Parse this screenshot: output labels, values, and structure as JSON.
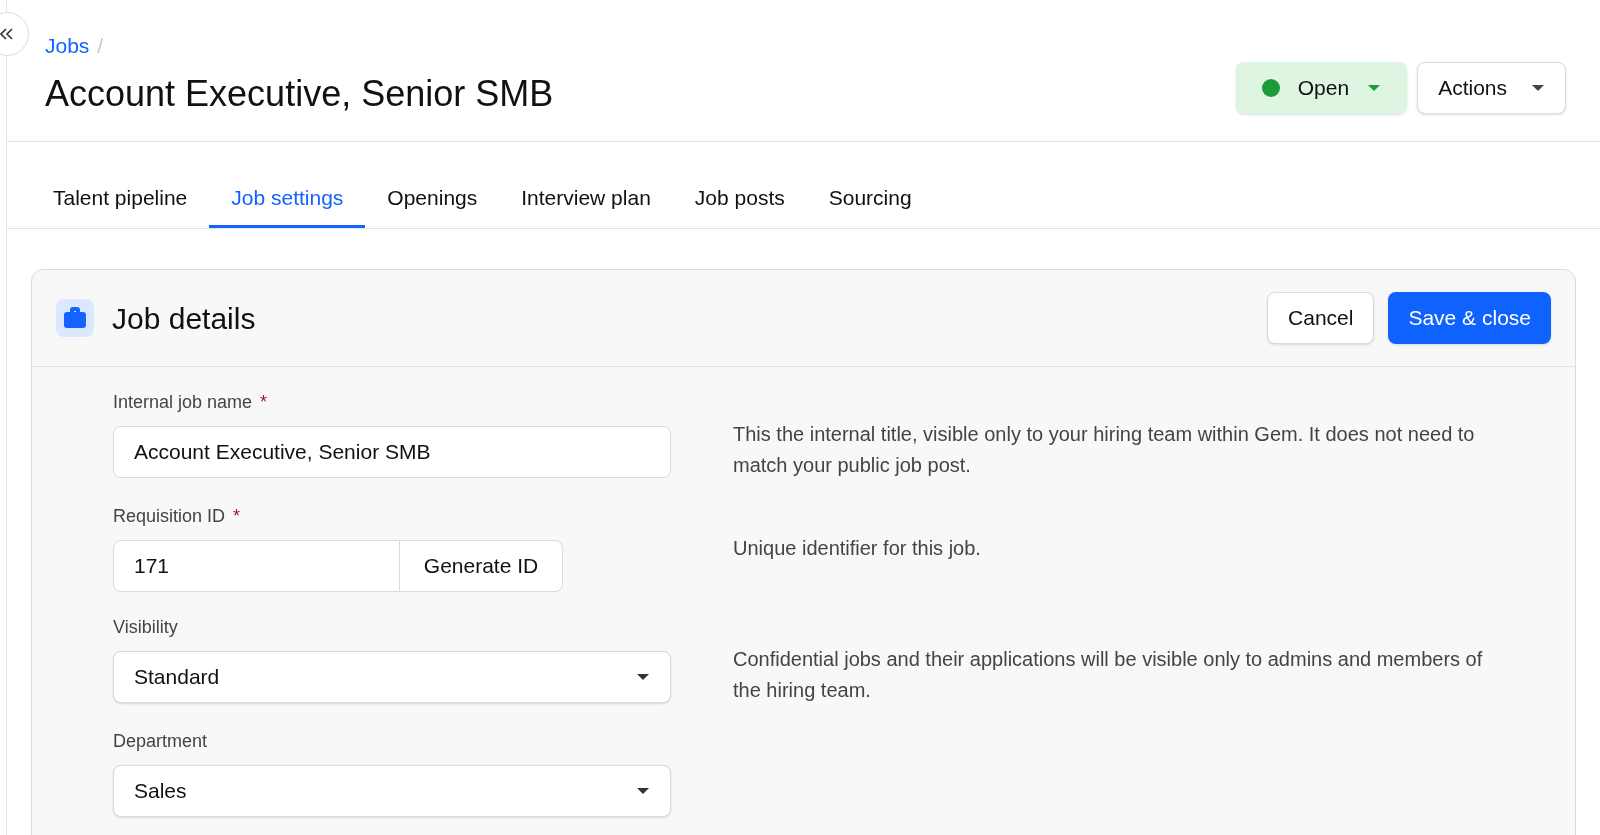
{
  "breadcrumb": {
    "link": "Jobs",
    "separator": "/"
  },
  "title": "Account Executive, Senior SMB",
  "status_button": {
    "label": "Open",
    "color": "#1e9a3a"
  },
  "actions_button": {
    "label": "Actions"
  },
  "tabs": [
    {
      "label": "Talent pipeline",
      "selected": false
    },
    {
      "label": "Job settings",
      "selected": true
    },
    {
      "label": "Openings",
      "selected": false
    },
    {
      "label": "Interview plan",
      "selected": false
    },
    {
      "label": "Job posts",
      "selected": false
    },
    {
      "label": "Sourcing",
      "selected": false
    }
  ],
  "card": {
    "title": "Job details",
    "buttons": [
      {
        "label": "Cancel",
        "kind": "secondary"
      },
      {
        "label": "Save & close",
        "kind": "primary"
      }
    ],
    "fields": [
      {
        "kind": "text",
        "label": "Internal job name",
        "required_mark": "*",
        "value": "Account Executive, Senior SMB",
        "help": "This the internal title, visible only to your hiring team within Gem. It does not need to match your public job post."
      },
      {
        "kind": "text_with_button",
        "label": "Requisition ID",
        "required_mark": "*",
        "value": "171",
        "button": "Generate ID",
        "help": "Unique identifier for this job."
      },
      {
        "kind": "select",
        "label": "Visibility",
        "value": "Standard",
        "help": "Confidential jobs and their applications will be visible only to admins and members of the hiring team."
      },
      {
        "kind": "select",
        "label": "Department",
        "value": "Sales"
      }
    ]
  }
}
